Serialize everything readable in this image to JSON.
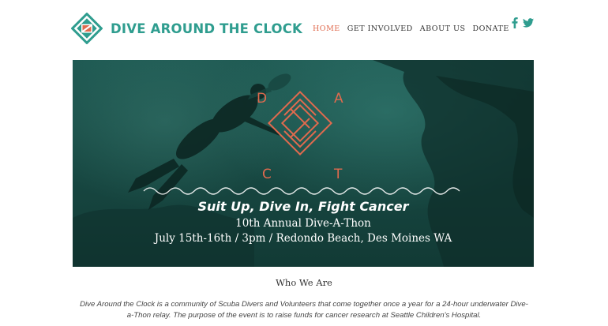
{
  "header": {
    "site_title": "DIVE AROUND THE CLOCK",
    "logo_icon": "dive-flag-diamond-icon"
  },
  "nav": {
    "items": [
      {
        "label": "HOME",
        "active": true
      },
      {
        "label": "GET INVOLVED"
      },
      {
        "label": "ABOUT US"
      },
      {
        "label": "DONATE"
      }
    ]
  },
  "social": {
    "icons": [
      "facebook-icon",
      "twitter-icon"
    ]
  },
  "hero": {
    "logo_letters": [
      "D",
      "A",
      "C",
      "T"
    ],
    "tagline": "Suit Up, Dive In, Fight Cancer",
    "line1": "10th Annual Dive-A-Thon",
    "line2": "July 15th-16th / 3pm / Redondo Beach, Des Moines WA"
  },
  "about": {
    "title": "Who We Are",
    "body": "Dive Around the Clock is a community of Scuba Divers and Volunteers that come together once a year for a 24-hour underwater Dive-a-Thon relay. The purpose of the event is to raise funds for cancer research at Seattle Children's Hospital."
  },
  "colors": {
    "brand_teal": "#2f9d8f",
    "accent_orange": "#e06a4e",
    "hero_dark": "#184a44"
  }
}
